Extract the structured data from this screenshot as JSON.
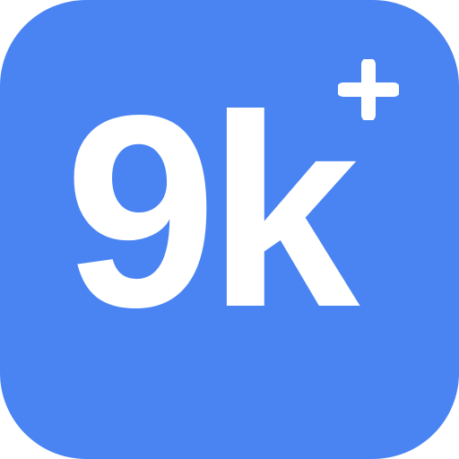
{
  "icon": {
    "label": "9k",
    "badge_icon": "plus-icon",
    "colors": {
      "background": "#4a84f2",
      "foreground": "#ffffff"
    }
  }
}
